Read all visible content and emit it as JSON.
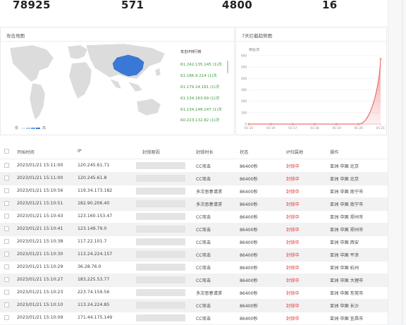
{
  "stats": [
    {
      "value": "78925"
    },
    {
      "value": "571"
    },
    {
      "value": "4800"
    },
    {
      "value": "16"
    }
  ],
  "map_panel": {
    "title": "攻击地图",
    "rank_title": "攻击IP排行榜",
    "rank_items": [
      "61.242.135.145  (1)次",
      "61.186.9.214  (1)次",
      "61.179.24.181  (1)次",
      "61.134.163.69  (1)次",
      "61.134.148.147  (1)次",
      "60.223.132.82  (1)次"
    ],
    "legend_low": "低",
    "legend_high": "高",
    "highlight_color": "#3a78d8"
  },
  "trend_panel": {
    "title": "7天拦截趋势图",
    "chart_data": {
      "type": "area",
      "title": "",
      "ylabel": "单位/次",
      "x": [
        "01-15",
        "01-16",
        "01-17",
        "01-18",
        "01-19",
        "01-20",
        "01-21"
      ],
      "series": [
        {
          "values": [
            0,
            0,
            0,
            0,
            0,
            0,
            571
          ]
        }
      ],
      "yticks": [
        0,
        100,
        200,
        300,
        400,
        500,
        600
      ],
      "ylim": [
        0,
        600
      ],
      "grid": true,
      "color": "#e55050"
    }
  },
  "table": {
    "headers": [
      "开始时间",
      "IP",
      "封锁原因",
      "封锁时长",
      "状态",
      "IP归属地",
      "操作"
    ],
    "rows": [
      {
        "time": "2023/01/21 15:11:00",
        "ip": "120.245.61.71",
        "reason_type": "CC攻击",
        "duration": "86400秒",
        "status": "封锁中",
        "location": "亚洲 中国 北京"
      },
      {
        "time": "2023/01/21 15:11:00",
        "ip": "120.245.61.8",
        "reason_type": "CC攻击",
        "duration": "86400秒",
        "status": "封锁中",
        "location": "亚洲 中国 北京"
      },
      {
        "time": "2023/01/21 15:10:56",
        "ip": "119.34.173.182",
        "reason_type": "多次恶意请求",
        "duration": "86400秒",
        "status": "封锁中",
        "location": "亚洲 中国 南宁市"
      },
      {
        "time": "2023/01/21 15:10:51",
        "ip": "182.90.206.40",
        "reason_type": "多次恶意请求",
        "duration": "86400秒",
        "status": "封锁中",
        "location": "亚洲 中国 南宁市"
      },
      {
        "time": "2023/01/21 15:10:43",
        "ip": "123.160.153.47",
        "reason_type": "CC攻击",
        "duration": "86400秒",
        "status": "封锁中",
        "location": "亚洲 中国 郑州市"
      },
      {
        "time": "2023/01/21 15:10:41",
        "ip": "123.149.79.0",
        "reason_type": "CC攻击",
        "duration": "86400秒",
        "status": "封锁中",
        "location": "亚洲 中国 郑州市"
      },
      {
        "time": "2023/01/21 15:10:38",
        "ip": "117.22.101.7",
        "reason_type": "CC攻击",
        "duration": "86400秒",
        "status": "封锁中",
        "location": "亚洲 中国 西安"
      },
      {
        "time": "2023/01/21 15:10:30",
        "ip": "113.24.224.157",
        "reason_type": "CC攻击",
        "duration": "86400秒",
        "status": "封锁中",
        "location": "亚洲 中国 平凉"
      },
      {
        "time": "2023/01/21 15:10:29",
        "ip": "36.28.76.0",
        "reason_type": "CC攻击",
        "duration": "86400秒",
        "status": "封锁中",
        "location": "亚洲 中国 杭州"
      },
      {
        "time": "2023/01/21 15:10:27",
        "ip": "183.225.53.77",
        "reason_type": "CC攻击",
        "duration": "86400秒",
        "status": "封锁中",
        "location": "亚洲 中国 大理市"
      },
      {
        "time": "2023/01/21 15:10:23",
        "ip": "223.74.159.56",
        "reason_type": "多次恶意请求",
        "duration": "86400秒",
        "status": "封锁中",
        "location": "亚洲 中国 东莞市"
      },
      {
        "time": "2023/01/21 15:10:10",
        "ip": "113.24.224.85",
        "reason_type": "CC攻击",
        "duration": "86400秒",
        "status": "封锁中",
        "location": "亚洲 中国 长沙"
      },
      {
        "time": "2023/01/21 15:10:09",
        "ip": "171.44.175.149",
        "reason_type": "CC攻击",
        "duration": "86400秒",
        "status": "封锁中",
        "location": "亚洲 中国 宜昌市"
      }
    ]
  }
}
